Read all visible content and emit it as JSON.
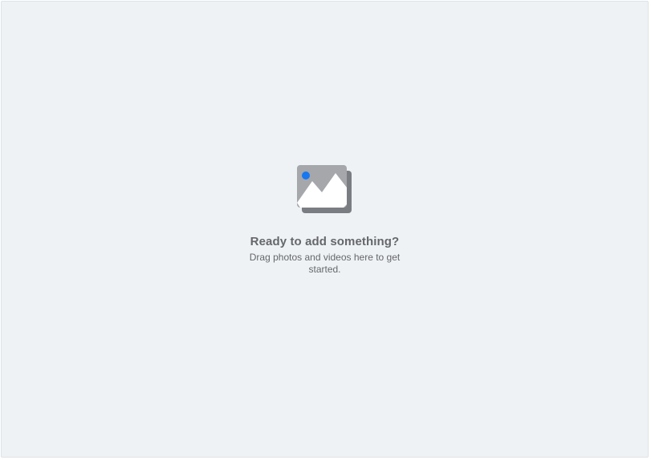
{
  "empty_state": {
    "icon": "photo-stack-icon",
    "title": "Ready to add something?",
    "subtitle": "Drag photos and videos here to get started."
  },
  "colors": {
    "background": "#eff2f5",
    "text": "#65676b",
    "icon_back": "#7a7d82",
    "icon_front": "#a5a7ab",
    "icon_accent": "#1877f2"
  }
}
